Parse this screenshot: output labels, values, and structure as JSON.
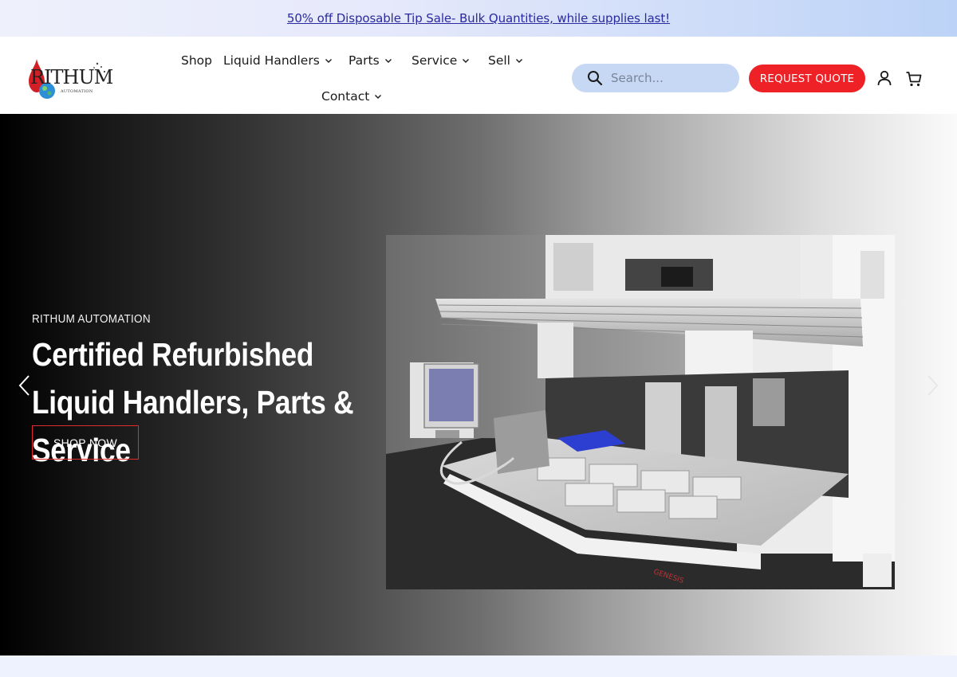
{
  "announcement": {
    "text": "50% off Disposable Tip Sale- Bulk Quantities, while supplies last!"
  },
  "logo": {
    "wordmark": "RITHUM",
    "subtitle": "AUTOMATION"
  },
  "nav": {
    "items": [
      {
        "label": "Shop",
        "has_dropdown": false
      },
      {
        "label": "Liquid Handlers",
        "has_dropdown": true
      },
      {
        "label": "Parts",
        "has_dropdown": true
      },
      {
        "label": "Service",
        "has_dropdown": true
      },
      {
        "label": "Sell",
        "has_dropdown": true
      },
      {
        "label": "Contact",
        "has_dropdown": true
      }
    ]
  },
  "search": {
    "placeholder": "Search..."
  },
  "header_actions": {
    "request_quote_label": "REQUEST QUOTE",
    "account_icon": "user-icon",
    "cart_icon": "cart-icon"
  },
  "hero": {
    "eyebrow": "RITHUM AUTOMATION",
    "headline": "Certified Refurbished Liquid Handlers, Parts & Service",
    "cta_label": "SHOP NOW",
    "prev_icon": "chevron-left-icon",
    "next_icon": "chevron-right-icon",
    "image_subject": "liquid-handler-robot",
    "machine_label": "GENESIS"
  },
  "colors": {
    "accent_red": "#ee2127",
    "search_bg": "#c6d8f3",
    "announcement_link": "#2a2aa0"
  }
}
